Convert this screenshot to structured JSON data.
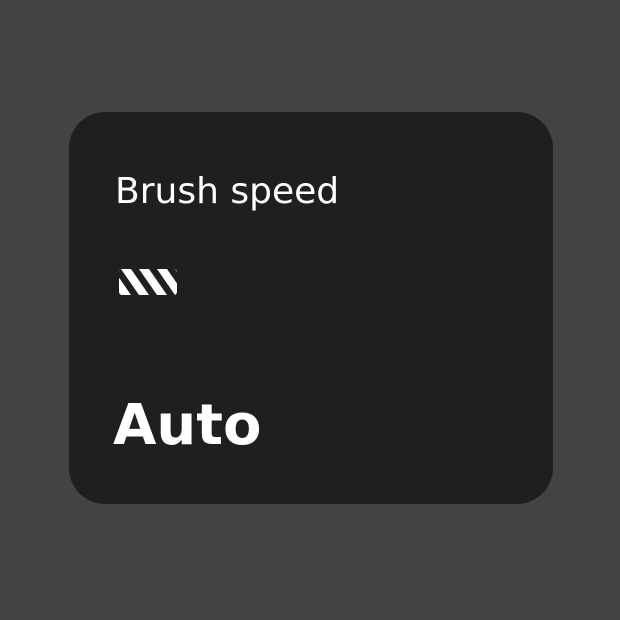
{
  "widget": {
    "title": "Brush speed",
    "icon": "brush-speed-icon",
    "value": "Auto"
  },
  "colors": {
    "background": "#434343",
    "card": "#1f1f1f",
    "text": "#ffffff"
  }
}
